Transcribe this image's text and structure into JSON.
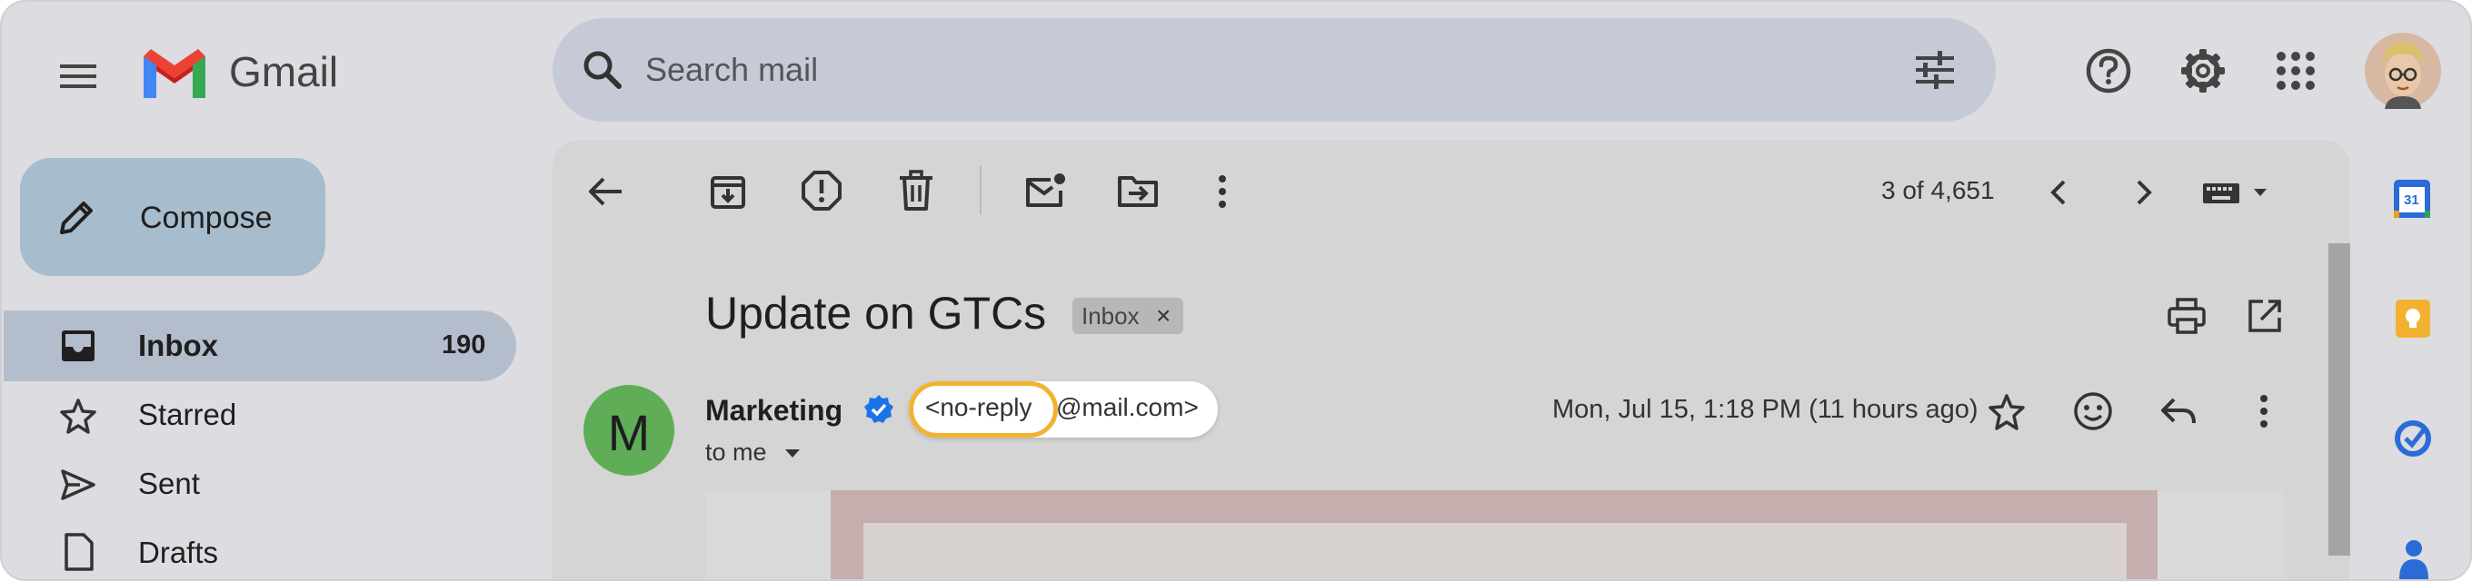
{
  "app": {
    "name": "Gmail"
  },
  "search": {
    "placeholder": "Search mail"
  },
  "compose": {
    "label": "Compose"
  },
  "sidebar": {
    "items": [
      {
        "label": "Inbox",
        "count": "190"
      },
      {
        "label": "Starred"
      },
      {
        "label": "Sent"
      },
      {
        "label": "Drafts"
      }
    ]
  },
  "toolbar": {
    "pagination": "3 of 4,651"
  },
  "email": {
    "subject": "Update on GTCs",
    "label_chip": "Inbox",
    "label_chip_close": "×",
    "sender_initial": "M",
    "sender_name": "Marketing",
    "sender_email_highlight": "<no-reply",
    "sender_email_rest": "@mail.com>",
    "recipient": "to me",
    "date": "Mon, Jul 15, 1:18 PM (11 hours ago)"
  },
  "side_panel": {
    "calendar_day": "31"
  },
  "colors": {
    "accent_compose": "#a7bccc",
    "selected_row": "#b4bdcc",
    "avatar_green": "#5fad56",
    "highlight_yellow": "#f2b230",
    "verified_blue": "#1a73e8"
  },
  "icons": [
    "menu-icon",
    "gmail-logo",
    "search-icon",
    "tune-icon",
    "help-icon",
    "settings-icon",
    "apps-icon",
    "avatar",
    "pencil-icon",
    "inbox-icon",
    "star-icon",
    "send-icon",
    "draft-icon",
    "back-icon",
    "archive-icon",
    "report-spam-icon",
    "delete-icon",
    "mark-unread-icon",
    "move-to-icon",
    "more-vert-icon",
    "chevron-left-icon",
    "chevron-right-icon",
    "keyboard-icon",
    "print-icon",
    "open-in-new-icon",
    "verified-icon",
    "reply-icon",
    "emoji-icon",
    "calendar-icon",
    "keep-icon",
    "tasks-icon",
    "contacts-icon"
  ]
}
